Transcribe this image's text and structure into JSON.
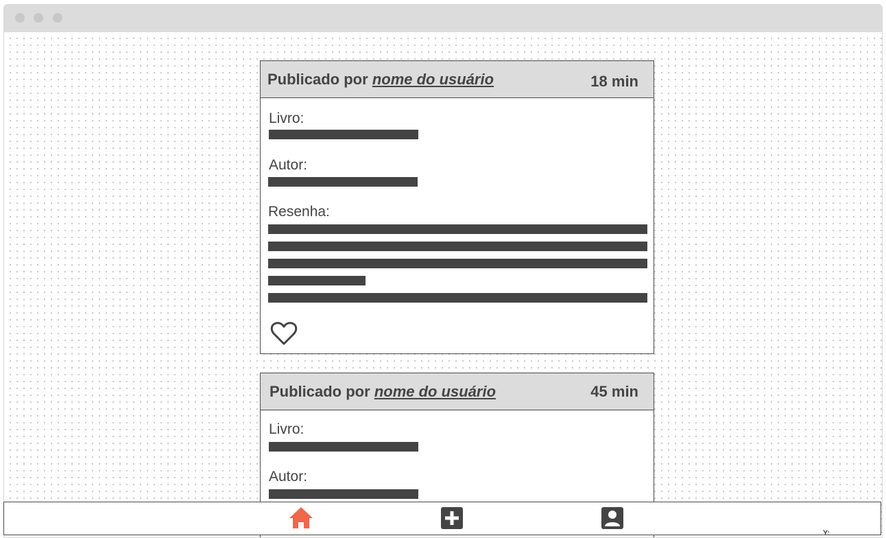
{
  "window": {
    "controls": [
      "close-dot",
      "minimize-dot",
      "maximize-dot"
    ]
  },
  "posts": [
    {
      "posted_prefix": "Publicado por",
      "username": "nome do usuário",
      "time": "18 min",
      "book_label": "Livro:",
      "author_label": "Autor:",
      "review_label": "Resenha:",
      "like_icon": "heart-outline-icon"
    },
    {
      "posted_prefix": "Publicado por",
      "username": "nome do usuário",
      "time": "45 min",
      "book_label": "Livro:",
      "author_label": "Autor:"
    }
  ],
  "bottom_nav": {
    "items": [
      {
        "icon": "home-icon",
        "active": true,
        "color": "#f0674b"
      },
      {
        "icon": "add-square-icon",
        "active": false,
        "color": "#444444"
      },
      {
        "icon": "profile-icon",
        "active": false,
        "color": "#444444"
      }
    ]
  },
  "corner_text": "Y:",
  "colors": {
    "accent": "#f0674b",
    "ink": "#444444",
    "header_bg": "#dcdcdc"
  }
}
